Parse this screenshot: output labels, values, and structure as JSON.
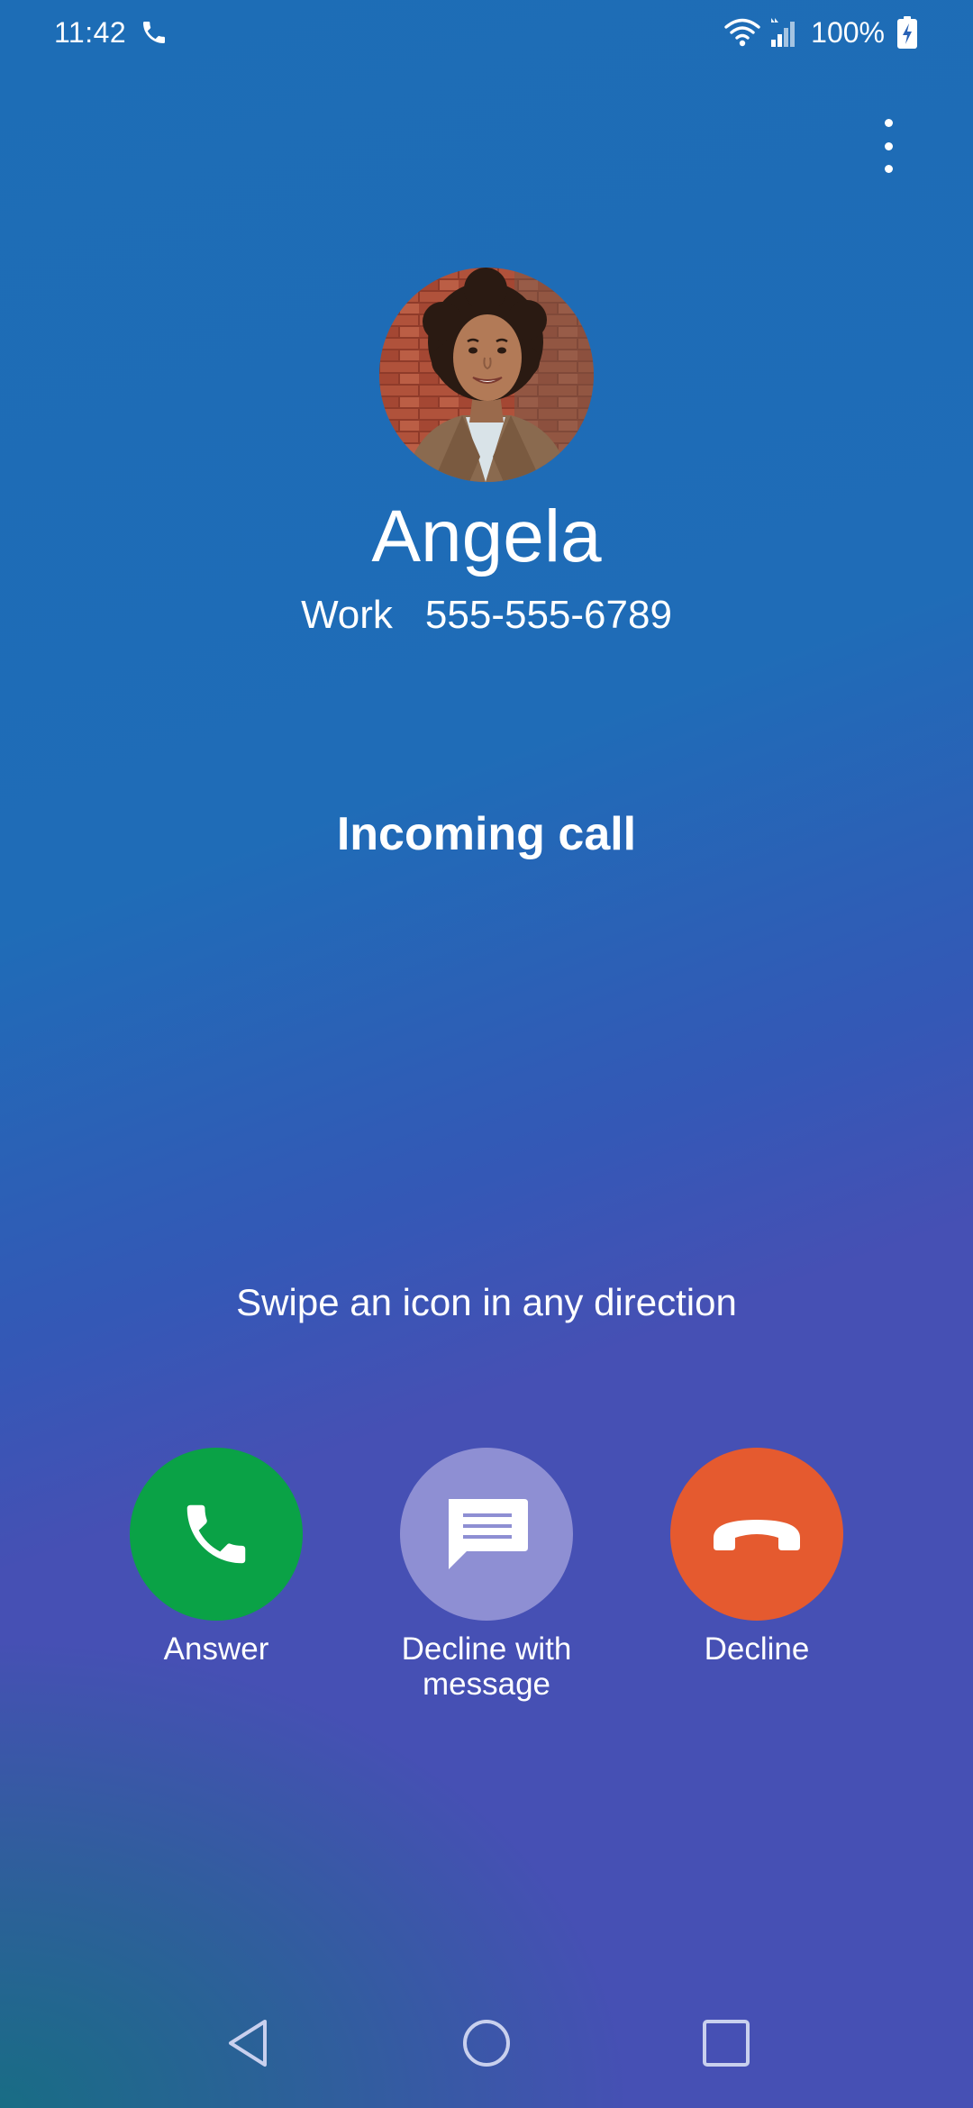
{
  "status_bar": {
    "time": "11:42",
    "battery": "100%",
    "icons": [
      "phone-icon",
      "wifi-icon",
      "signal-icon",
      "battery-charging-icon"
    ]
  },
  "menu": {
    "icon": "more-vertical-icon"
  },
  "caller": {
    "name": "Angela",
    "label": "Work",
    "number": "555-555-6789",
    "avatar_icon": "contact-photo"
  },
  "call": {
    "status": "Incoming call",
    "hint": "Swipe an icon in any direction"
  },
  "actions": {
    "answer": {
      "label": "Answer",
      "icon": "phone-icon",
      "color": "#0aa246"
    },
    "message": {
      "label": "Decline with message",
      "icon": "message-icon",
      "color": "#8e8fd3"
    },
    "decline": {
      "label": "Decline",
      "icon": "hang-up-icon",
      "color": "#e55a2f"
    }
  },
  "nav": {
    "back_icon": "back-triangle-icon",
    "home_icon": "home-circle-icon",
    "recents_icon": "recents-square-icon"
  },
  "colors": {
    "background_top": "#1d6db6",
    "background_bottom": "#4650b4"
  }
}
